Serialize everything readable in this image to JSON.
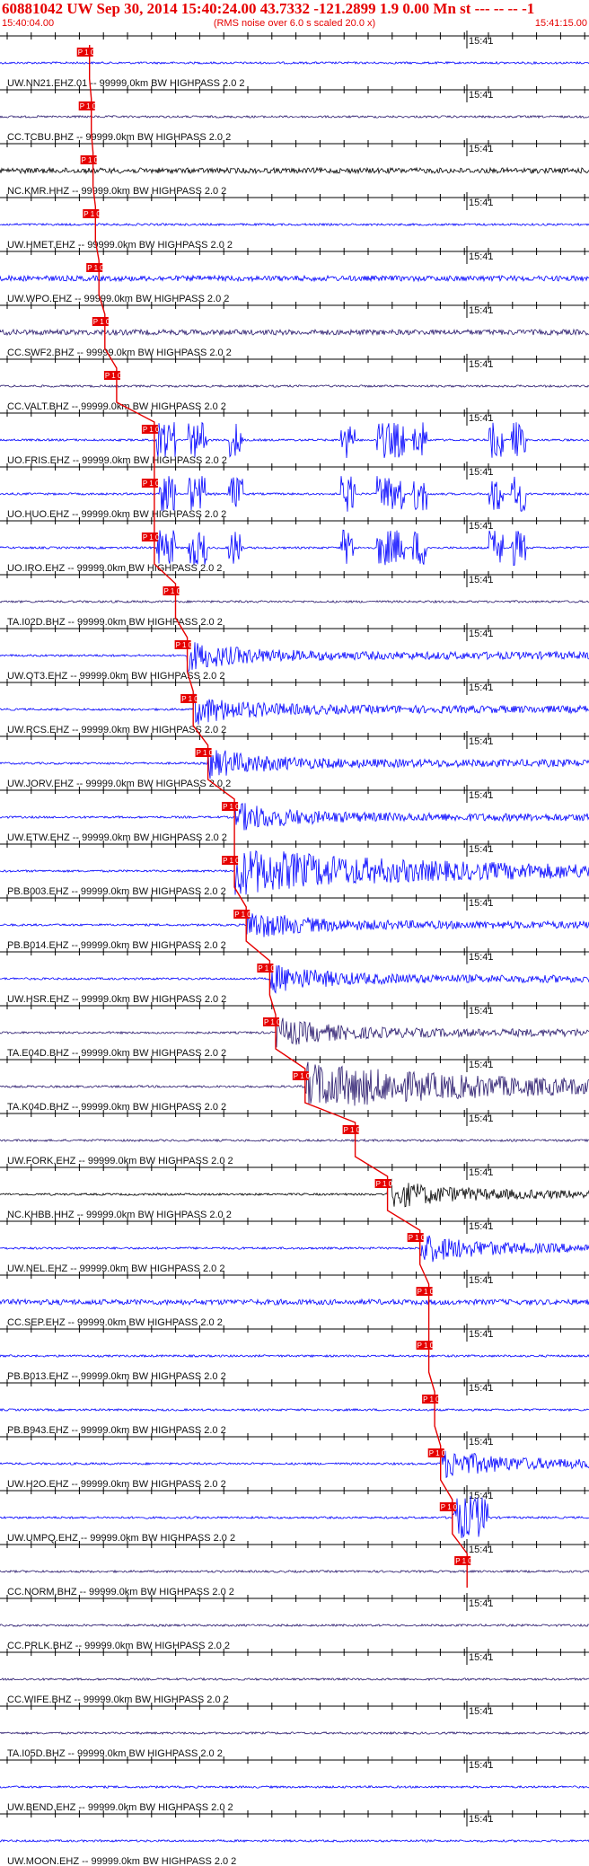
{
  "header": {
    "title": "60881042 UW Sep 30, 2014 15:40:24.00   43.7332 -121.2899  1.9 0.00 Mn st --- -- --  -1",
    "start_time": "15:40:04.00",
    "rms_note": "(RMS noise over 6.0 s scaled 20.0 x)",
    "end_time": "15:41:15.00"
  },
  "time_marker_label": "15:41",
  "pick_label": "P 1.0",
  "colors": {
    "header_text": "#e60000",
    "pick": "#e60000",
    "axis": "#000000",
    "trace_blue": "#0000ff",
    "trace_purple": "#2a1a6e",
    "trace_black": "#000000"
  },
  "traces": [
    {
      "label": "UW.NN21.EHZ.01 -- 99999.0km BW  HIGHPASS  2.0  2",
      "color": "blue",
      "pick": 0.152,
      "activity": "low"
    },
    {
      "label": "CC.TCBU.BHZ -- 99999.0km BW  HIGHPASS  2.0  2",
      "color": "purple",
      "pick": 0.155,
      "activity": "low"
    },
    {
      "label": "NC.KMR.HHZ -- 99999.0km BW  HIGHPASS  2.0  2",
      "color": "black",
      "pick": 0.158,
      "activity": "med"
    },
    {
      "label": "UW.HMET.EHZ -- 99999.0km BW  HIGHPASS  2.0  2",
      "color": "blue",
      "pick": 0.162,
      "activity": "low"
    },
    {
      "label": "UW.WPO.EHZ -- 99999.0km BW  HIGHPASS  2.0  2",
      "color": "blue",
      "pick": 0.168,
      "activity": "med"
    },
    {
      "label": "CC.SWF2.BHZ -- 99999.0km BW  HIGHPASS  2.0  2",
      "color": "purple",
      "pick": 0.178,
      "activity": "med"
    },
    {
      "label": "CC.VALT.BHZ -- 99999.0km BW  HIGHPASS  2.0  2",
      "color": "purple",
      "pick": 0.198,
      "activity": "low"
    },
    {
      "label": "UO.FRIS.EHZ -- 99999.0km BW  HIGHPASS  2.0  2",
      "color": "blue",
      "pick": 0.262,
      "activity": "burst"
    },
    {
      "label": "UO.HUO.EHZ -- 99999.0km BW  HIGHPASS  2.0  2",
      "color": "blue",
      "pick": 0.262,
      "activity": "burst"
    },
    {
      "label": "UO.IRO.EHZ -- 99999.0km BW  HIGHPASS  2.0  2",
      "color": "blue",
      "pick": 0.262,
      "activity": "burst"
    },
    {
      "label": "TA.I02D.BHZ -- 99999.0km BW  HIGHPASS  2.0  2",
      "color": "purple",
      "pick": 0.298,
      "activity": "low"
    },
    {
      "label": "UW.OT3.EHZ -- 99999.0km BW  HIGHPASS  2.0  2",
      "color": "blue",
      "pick": 0.318,
      "activity": "quake"
    },
    {
      "label": "UW.RCS.EHZ -- 99999.0km BW  HIGHPASS  2.0  2",
      "color": "blue",
      "pick": 0.328,
      "activity": "quake"
    },
    {
      "label": "UW.JORV.EHZ -- 99999.0km BW  HIGHPASS  2.0  2",
      "color": "blue",
      "pick": 0.353,
      "activity": "quake"
    },
    {
      "label": "UW.ETW.EHZ -- 99999.0km BW  HIGHPASS  2.0  2",
      "color": "blue",
      "pick": 0.398,
      "activity": "quake"
    },
    {
      "label": "PB.B003.EHZ -- 99999.0km BW  HIGHPASS  2.0  2",
      "color": "blue",
      "pick": 0.398,
      "activity": "big"
    },
    {
      "label": "PB.B014.EHZ -- 99999.0km BW  HIGHPASS  2.0  2",
      "color": "blue",
      "pick": 0.418,
      "activity": "quake"
    },
    {
      "label": "UW.HSR.EHZ -- 99999.0km BW  HIGHPASS  2.0  2",
      "color": "blue",
      "pick": 0.458,
      "activity": "quake"
    },
    {
      "label": "TA.E04D.BHZ -- 99999.0km BW  HIGHPASS  2.0  2",
      "color": "purple",
      "pick": 0.468,
      "activity": "quake"
    },
    {
      "label": "TA.K04D.BHZ -- 99999.0km BW  HIGHPASS  2.0  2",
      "color": "purple",
      "pick": 0.518,
      "activity": "big"
    },
    {
      "label": "UW.FORK.EHZ -- 99999.0km BW  HIGHPASS  2.0  2",
      "color": "purple",
      "pick": 0.603,
      "activity": "low"
    },
    {
      "label": "NC.KHBB.HHZ -- 99999.0km BW  HIGHPASS  2.0  2",
      "color": "black",
      "pick": 0.658,
      "activity": "quake"
    },
    {
      "label": "UW.NEL.EHZ -- 99999.0km BW  HIGHPASS  2.0  2",
      "color": "blue",
      "pick": 0.713,
      "activity": "quake"
    },
    {
      "label": "CC.SEP.EHZ -- 99999.0km BW  HIGHPASS  2.0  2",
      "color": "blue",
      "pick": 0.728,
      "activity": "med"
    },
    {
      "label": "PB.B013.EHZ -- 99999.0km BW  HIGHPASS  2.0  2",
      "color": "blue",
      "pick": 0.728,
      "activity": "low"
    },
    {
      "label": "PB.B943.EHZ -- 99999.0km BW  HIGHPASS  2.0  2",
      "color": "blue",
      "pick": 0.738,
      "activity": "low"
    },
    {
      "label": "UW.H2O.EHZ -- 99999.0km BW  HIGHPASS  2.0  2",
      "color": "blue",
      "pick": 0.748,
      "activity": "quake"
    },
    {
      "label": "UW.UMPQ.EHZ -- 99999.0km BW  HIGHPASS  2.0  2",
      "color": "blue",
      "pick": 0.768,
      "activity": "block"
    },
    {
      "label": "CC.NORM.BHZ -- 99999.0km BW  HIGHPASS  2.0  2",
      "color": "purple",
      "pick": 0.793,
      "activity": "low"
    },
    {
      "label": "CC.PRLK.BHZ -- 99999.0km BW  HIGHPASS  2.0  2",
      "color": "purple",
      "pick": null,
      "activity": "low"
    },
    {
      "label": "CC.WIFE.BHZ -- 99999.0km BW  HIGHPASS  2.0  2",
      "color": "purple",
      "pick": null,
      "activity": "low"
    },
    {
      "label": "TA.I05D.BHZ -- 99999.0km BW  HIGHPASS  2.0  2",
      "color": "purple",
      "pick": null,
      "activity": "low"
    },
    {
      "label": "UW.BEND.EHZ -- 99999.0km BW  HIGHPASS  2.0  2",
      "color": "blue",
      "pick": null,
      "activity": "low"
    },
    {
      "label": "UW.MOON.EHZ -- 99999.0km BW  HIGHPASS  2.0  2",
      "color": "blue",
      "pick": null,
      "activity": "low"
    }
  ]
}
